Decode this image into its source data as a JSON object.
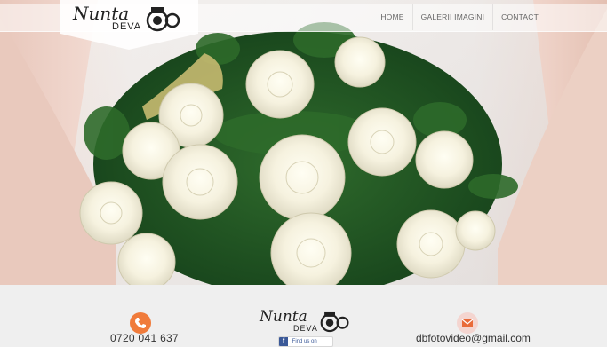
{
  "brand": {
    "line1": "Nunta",
    "line2": "DEVA"
  },
  "nav": {
    "items": [
      "HOME",
      "GALERII IMAGINI",
      "CONTACT"
    ]
  },
  "contact": {
    "phone": "0720 041 637",
    "email": "dbfotovideo@gmail.com",
    "facebook_label": "Find us on"
  },
  "colors": {
    "accent": "#f07b3b",
    "mail_bg": "#f4d5d0",
    "text": "#333333",
    "footer_bg": "#efefef"
  },
  "icons": {
    "phone": "phone-icon",
    "mail": "mail-icon",
    "camera": "camera-icon",
    "facebook": "facebook-icon"
  }
}
